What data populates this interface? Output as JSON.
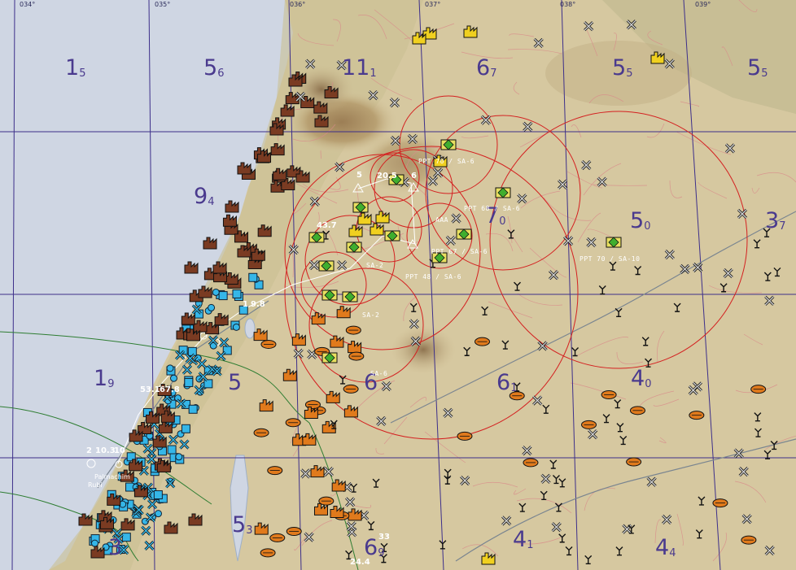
{
  "map": {
    "longitude_labels": [
      "034°",
      "035°",
      "036°",
      "037°",
      "038°",
      "039°"
    ],
    "zones": [
      {
        "main": "1",
        "sub": "5"
      },
      {
        "main": "5",
        "sub": "6"
      },
      {
        "main": "11",
        "sub": "1"
      },
      {
        "main": "6",
        "sub": "7"
      },
      {
        "main": "5",
        "sub": "5"
      },
      {
        "main": "5",
        "sub": "5"
      },
      {
        "main": "9",
        "sub": "4"
      },
      {
        "main": "1",
        "sub": "9"
      },
      {
        "main": "7",
        "sub": "0"
      },
      {
        "main": "5",
        "sub": "0"
      },
      {
        "main": "3",
        "sub": "7"
      },
      {
        "main": "5",
        "sub": ""
      },
      {
        "main": "6",
        "sub": ""
      },
      {
        "main": "6",
        "sub": "1"
      },
      {
        "main": "4",
        "sub": "0"
      },
      {
        "main": "3",
        "sub": ""
      },
      {
        "main": "5",
        "sub": "3"
      },
      {
        "main": "6",
        "sub": "9"
      },
      {
        "main": "4",
        "sub": "1"
      },
      {
        "main": "4",
        "sub": "4"
      }
    ],
    "sam_site_labels": [
      "PPT 68 / SA-6",
      "PPT 70 / SA-6",
      "PPT 70 / SA-10",
      "PPT 67 / SA-6",
      "PPT 48 / SA-6",
      "AAA",
      "SA-2",
      "SA-6",
      "SA-2"
    ],
    "waypoint_labels": [
      "5",
      "20.5",
      "6",
      "43.7",
      "53.1",
      "67.8",
      "2",
      "10.3",
      "10",
      "33",
      "24.4",
      "1",
      "9.8"
    ],
    "place_labels": [
      "Palmachim",
      "Rubi"
    ],
    "colors": {
      "sea": "#cfd6e3",
      "land": "#d6c8a0",
      "threat_ring": "#d42020",
      "grid": "#3d2f8a",
      "friendly": "#35b6e8",
      "enemy_ground": "#7a3b22",
      "enemy_orange": "#e07a1c",
      "enemy_yellow": "#f0d020",
      "sam": "#3fae2e",
      "route": "#2e7d32"
    }
  }
}
